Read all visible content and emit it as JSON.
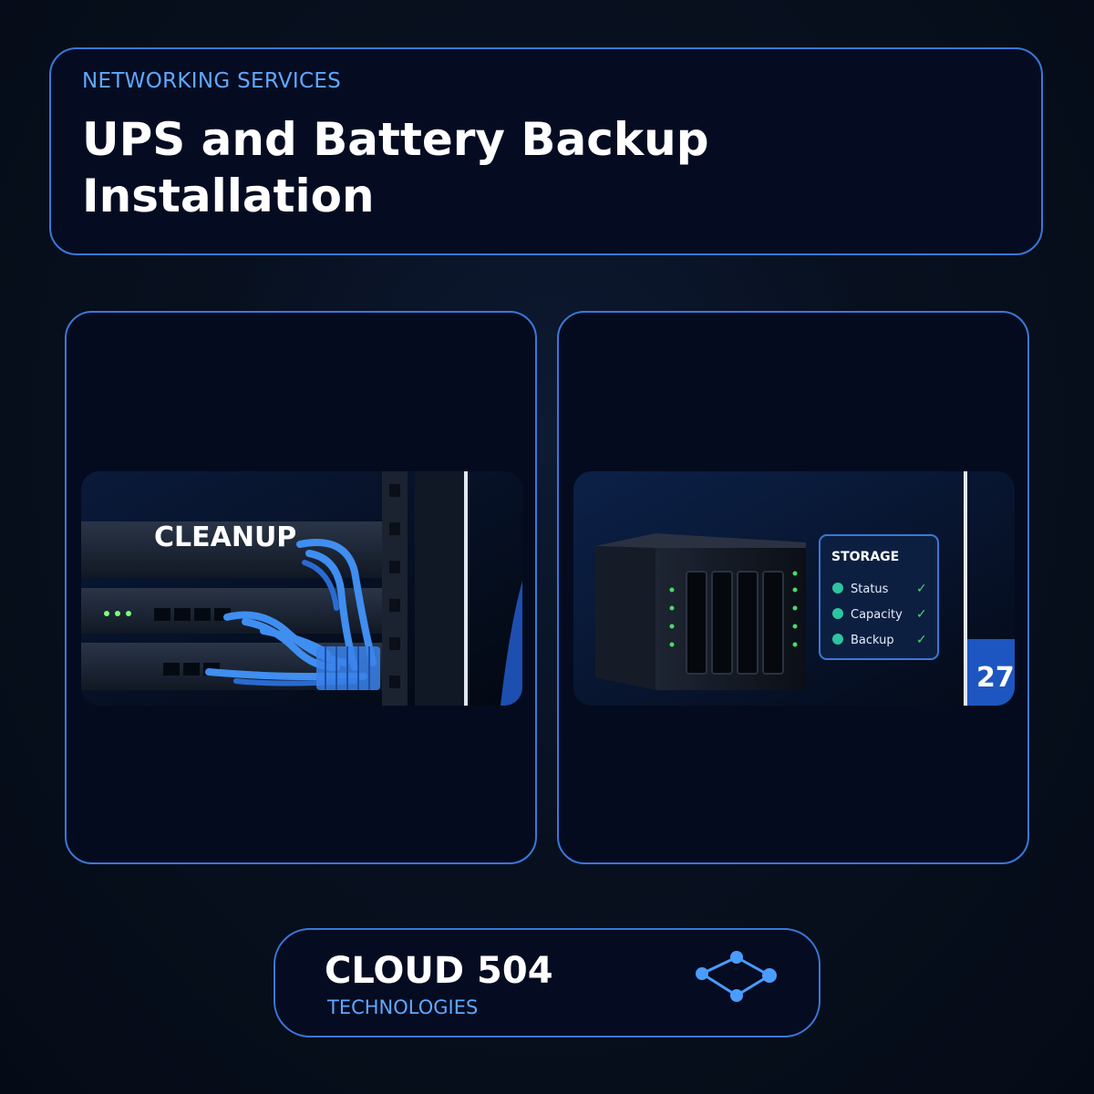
{
  "header": {
    "eyebrow": "NETWORKING SERVICES",
    "title": "UPS and Battery Backup Installation"
  },
  "cards": [
    {
      "image_label": "CLEANUP",
      "icon": "server-rack-cables-photo"
    },
    {
      "icon": "nas-storage-photo",
      "panel_title": "STORAGE",
      "panel_items": [
        "Status",
        "Capacity",
        "Backup"
      ],
      "badge": "27"
    }
  ],
  "brand": {
    "name": "CLOUD 504",
    "subtitle": "TECHNOLOGIES",
    "logo_icon": "network-nodes-icon"
  },
  "colors": {
    "accent": "#3a78d8",
    "accent_text": "#5fa8ff",
    "background": "#060d1c",
    "card_bg": "#050c22"
  }
}
